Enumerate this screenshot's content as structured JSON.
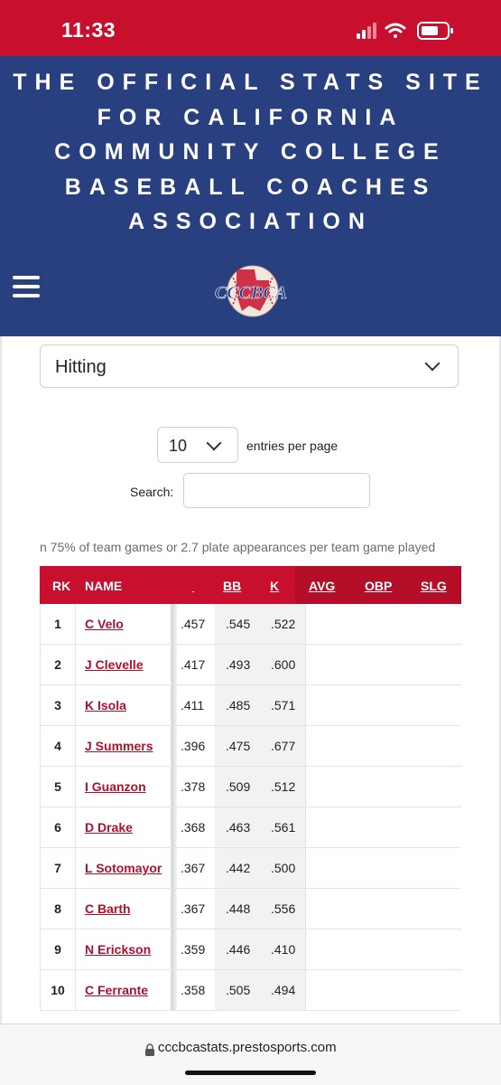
{
  "status_bar": {
    "time": "11:33"
  },
  "header": {
    "title_lines": [
      "THE OFFICIAL STATS SITE",
      "FOR CALIFORNIA",
      "COMMUNITY COLLEGE",
      "BASEBALL COACHES",
      "ASSOCIATION"
    ],
    "logo_text": "CCCBCA"
  },
  "category_select": {
    "value": "Hitting"
  },
  "entries": {
    "value": "10",
    "label": "entries per page"
  },
  "search": {
    "label": "Search:",
    "value": ""
  },
  "qualifier_note": "n 75% of team games or 2.7 plate appearances per team game played",
  "table": {
    "columns": {
      "rk": "RK",
      "name": "NAME",
      "bb": "BB",
      "k": "K",
      "avg": "AVG",
      "obp": "OBP",
      "slg": "SLG"
    },
    "rows": [
      {
        "rk": "1",
        "name": "C Velo",
        "avg": ".457",
        "obp": ".545",
        "slg": ".522"
      },
      {
        "rk": "2",
        "name": "J Clevelle",
        "avg": ".417",
        "obp": ".493",
        "slg": ".600"
      },
      {
        "rk": "3",
        "name": "K Isola",
        "avg": ".411",
        "obp": ".485",
        "slg": ".571"
      },
      {
        "rk": "4",
        "name": "J Summers",
        "avg": ".396",
        "obp": ".475",
        "slg": ".677"
      },
      {
        "rk": "5",
        "name": "I Guanzon",
        "avg": ".378",
        "obp": ".509",
        "slg": ".512"
      },
      {
        "rk": "6",
        "name": "D Drake",
        "avg": ".368",
        "obp": ".463",
        "slg": ".561"
      },
      {
        "rk": "7",
        "name": "L Sotomayor",
        "avg": ".367",
        "obp": ".442",
        "slg": ".500"
      },
      {
        "rk": "8",
        "name": "C Barth",
        "avg": ".367",
        "obp": ".448",
        "slg": ".556"
      },
      {
        "rk": "9",
        "name": "N Erickson",
        "avg": ".359",
        "obp": ".446",
        "slg": ".410"
      },
      {
        "rk": "10",
        "name": "C Ferrante",
        "avg": ".358",
        "obp": ".505",
        "slg": ".494"
      }
    ]
  },
  "browser": {
    "url": "cccbcastats.prestosports.com"
  },
  "colors": {
    "brand_red": "#c8102e",
    "brand_blue": "#283f80",
    "link_red": "#b0102d"
  },
  "icons": [
    "signal-icon",
    "wifi-icon",
    "battery-icon",
    "hamburger-icon",
    "chevron-down-icon",
    "lock-icon"
  ]
}
